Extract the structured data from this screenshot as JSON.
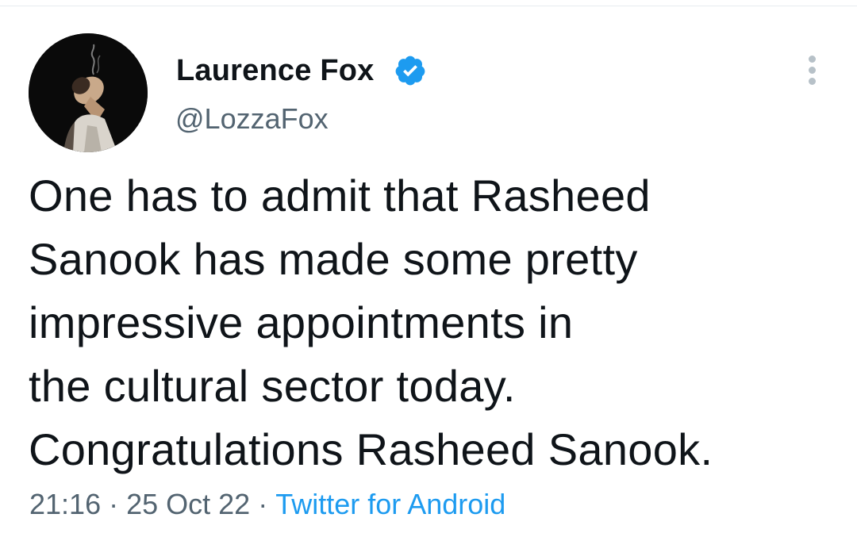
{
  "tweet": {
    "author": {
      "display_name": "Laurence Fox",
      "handle": "@LozzaFox",
      "verified": true,
      "avatar_icon": "profile-photo"
    },
    "text_lines": [
      "One has to admit that Rasheed",
      "Sanook has made some pretty",
      "impressive appointments in",
      "the cultural sector today.",
      "Congratulations Rasheed Sanook."
    ],
    "time": "21:16",
    "separator": "·",
    "date": "25 Oct 22",
    "source": "Twitter for Android",
    "more_icon": "more-vertical-icon"
  },
  "colors": {
    "text": "#0f1419",
    "secondary": "#536471",
    "link": "#1d9bf0",
    "verified_badge": "#1d9bf0"
  }
}
